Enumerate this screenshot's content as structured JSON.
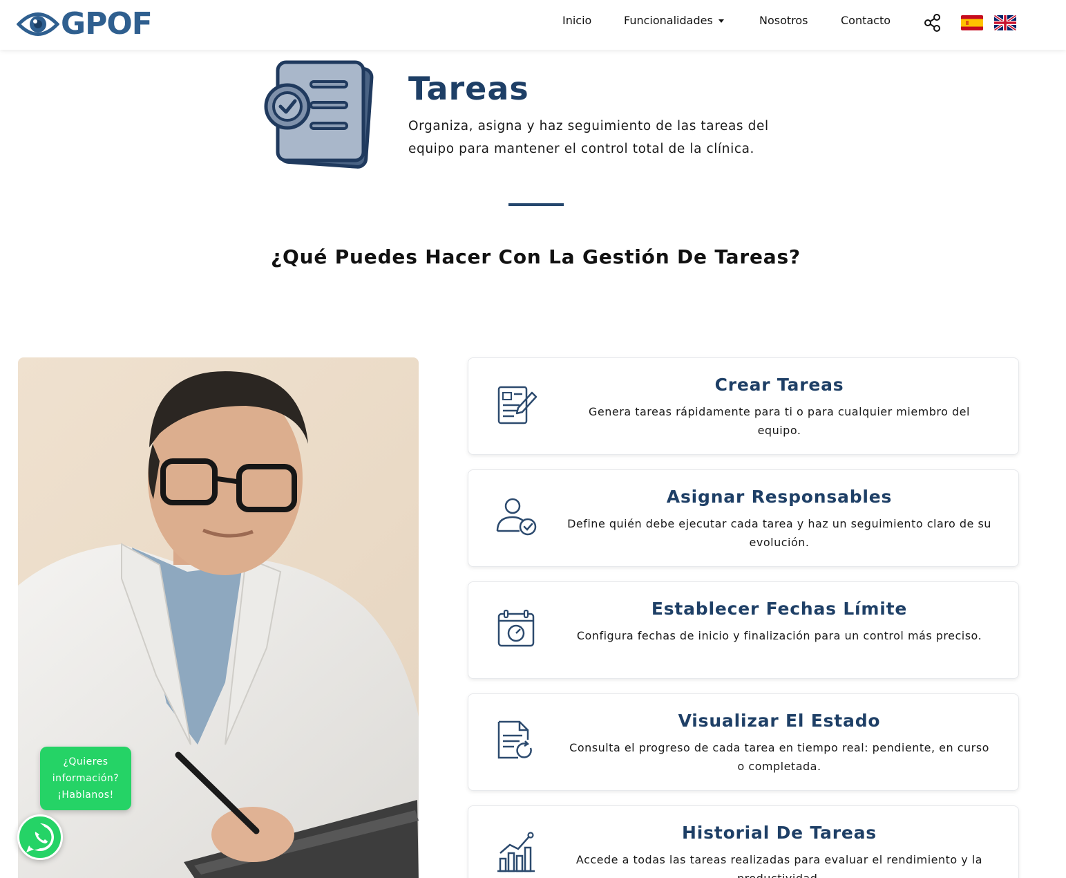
{
  "brand": {
    "logo_text": "GPOF",
    "logo_icon": "eye-icon",
    "color": "#2f5f8f"
  },
  "nav": {
    "items": [
      {
        "label": "Inicio"
      },
      {
        "label": "Funcionalidades"
      },
      {
        "label": "Nosotros"
      },
      {
        "label": "Contacto"
      }
    ],
    "share_icon": "share-icon",
    "languages": [
      "spain-flag-icon",
      "uk-flag-icon"
    ]
  },
  "hero": {
    "icon": "task-document-check-icon",
    "title": "Tareas",
    "description": "Organiza, asigna y haz seguimiento de las tareas del equipo para mantener el control total de la clínica."
  },
  "section": {
    "title": "¿Qué Puedes Hacer Con La Gestión De Tareas?"
  },
  "features": [
    {
      "icon": "edit-document-icon",
      "title": "Crear Tareas",
      "text": "Genera tareas rápidamente para ti o para cualquier miembro del equipo."
    },
    {
      "icon": "user-check-icon",
      "title": "Asignar Responsables",
      "text": "Define quién debe ejecutar cada tarea y haz un seguimiento claro de su evolución."
    },
    {
      "icon": "calendar-clock-icon",
      "title": "Establecer Fechas Límite",
      "text": "Configura fechas de inicio y finalización para un control más preciso."
    },
    {
      "icon": "document-refresh-icon",
      "title": "Visualizar El Estado",
      "text": "Consulta el progreso de cada tarea en tiempo real: pendiente, en curso o completada."
    },
    {
      "icon": "bar-chart-growth-icon",
      "title": "Historial De Tareas",
      "text": "Accede a todas las tareas realizadas para evaluar el rendimiento y la productividad."
    }
  ],
  "chat": {
    "line1": "¿Quieres",
    "line2": "información?",
    "line3": "¡Hablanos!",
    "color": "#25d366"
  },
  "colors": {
    "primary": "#1e3f66",
    "divider": "#24476d",
    "whatsapp": "#25d366"
  }
}
